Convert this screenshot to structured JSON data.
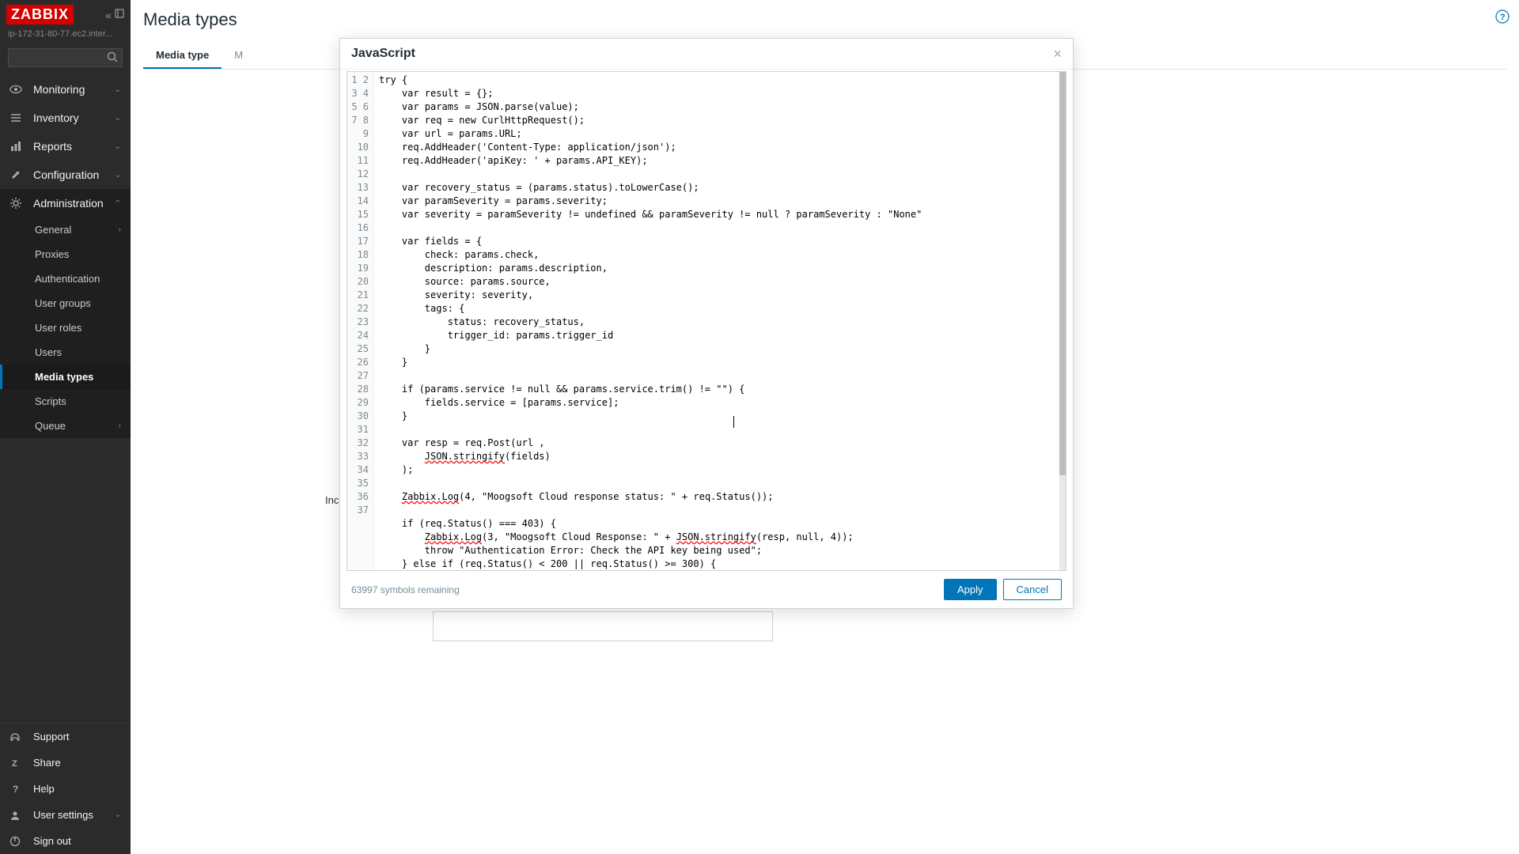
{
  "logo": "ZABBIX",
  "hostname": "ip-172-31-80-77.ec2.inter...",
  "search": {
    "placeholder": ""
  },
  "nav": {
    "monitoring": "Monitoring",
    "inventory": "Inventory",
    "reports": "Reports",
    "configuration": "Configuration",
    "administration": "Administration",
    "general": "General",
    "proxies": "Proxies",
    "authentication": "Authentication",
    "usergroups": "User groups",
    "userroles": "User roles",
    "users": "Users",
    "mediatypes": "Media types",
    "scripts": "Scripts",
    "queue": "Queue"
  },
  "footer_nav": {
    "support": "Support",
    "share": "Share",
    "help": "Help",
    "usersettings": "User settings",
    "signout": "Sign out"
  },
  "page": {
    "title": "Media types",
    "tab_mediatype": "Media type",
    "tab_next": "M",
    "incl_partial": "Incl"
  },
  "modal": {
    "title": "JavaScript",
    "symbols_remaining": "63997 symbols remaining",
    "apply": "Apply",
    "cancel": "Cancel"
  },
  "code": {
    "l1": "try {",
    "l2": "    var result = {};",
    "l3": "    var params = JSON.parse(value);",
    "l4": "    var req = new CurlHttpRequest();",
    "l5": "    var url = params.URL;",
    "l6": "    req.AddHeader('Content-Type: application/json');",
    "l7": "    req.AddHeader('apiKey: ' + params.API_KEY);",
    "l8": "",
    "l9": "    var recovery_status = (params.status).toLowerCase();",
    "l10": "    var paramSeverity = params.severity;",
    "l11": "    var severity = paramSeverity != undefined && paramSeverity != null ? paramSeverity : \"None\"",
    "l12": "",
    "l13": "    var fields = {",
    "l14": "        check: params.check,",
    "l15": "        description: params.description,",
    "l16": "        source: params.source,",
    "l17": "        severity: severity,",
    "l18": "        tags: {",
    "l19": "            status: recovery_status,",
    "l20": "            trigger_id: params.trigger_id",
    "l21": "        }",
    "l22": "    }",
    "l23": "",
    "l24": "    if (params.service != null && params.service.trim() != \"\") {",
    "l25": "        fields.service = [params.service];",
    "l26": "    }",
    "l27": "",
    "l28": "    var resp = req.Post(url ,",
    "l29a": "        ",
    "l29b": "JSON.stringify",
    "l29c": "(fields)",
    "l30": "    );",
    "l31": "",
    "l32a": "    ",
    "l32b": "Zabbix.Log",
    "l32c": "(4, \"Moogsoft Cloud response status: \" + req.Status());",
    "l33": "",
    "l34": "    if (req.Status() === 403) {",
    "l35a": "        ",
    "l35b": "Zabbix.Log",
    "l35c": "(3, \"Moogsoft Cloud Response: \" + ",
    "l35d": "JSON.stringify",
    "l35e": "(resp, null, 4));",
    "l36": "        throw \"Authentication Error: Check the API key being used\";",
    "l37": "    } else if (req.Status() < 200 || req.Status() >= 300) {"
  }
}
